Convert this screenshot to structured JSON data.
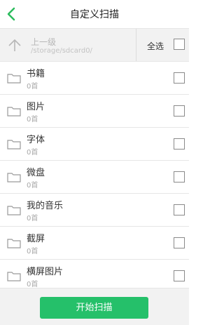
{
  "header": {
    "title": "自定义扫描",
    "back_icon": "chevron-left-icon",
    "accent": "#2bbb5d"
  },
  "parent": {
    "label": "上一级",
    "path": "/storage/sdcard0/",
    "select_all_label": "全选"
  },
  "folders": [
    {
      "name": "书籍",
      "count": "0首",
      "checked": false
    },
    {
      "name": "图片",
      "count": "0首",
      "checked": false
    },
    {
      "name": "字体",
      "count": "0首",
      "checked": false
    },
    {
      "name": "微盘",
      "count": "0首",
      "checked": false
    },
    {
      "name": "我的音乐",
      "count": "0首",
      "checked": false
    },
    {
      "name": "截屏",
      "count": "0首",
      "checked": false
    },
    {
      "name": "横屏图片",
      "count": "0首",
      "checked": false
    }
  ],
  "footer": {
    "start_label": "开始扫描",
    "button_color": "#25c06a"
  }
}
